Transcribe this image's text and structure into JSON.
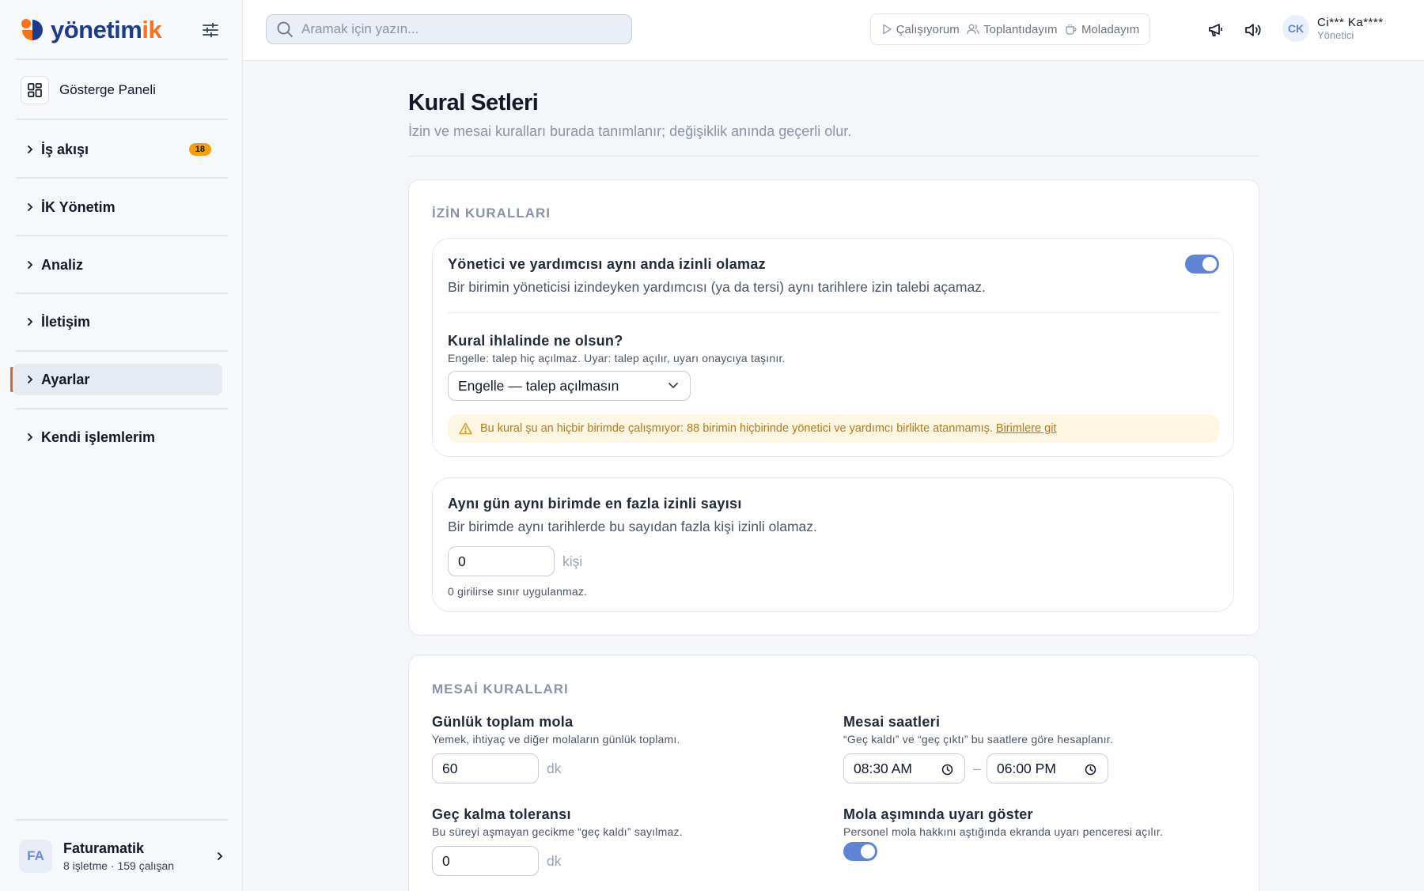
{
  "app": {
    "logo_text_main": "yönetim",
    "logo_text_accent": "ik"
  },
  "sidebar": {
    "dashboard_label": "Gösterge Paneli",
    "items": [
      {
        "label": "İş akışı",
        "badge": "18"
      },
      {
        "label": "İK Yönetim"
      },
      {
        "label": "Analiz"
      },
      {
        "label": "İletişim"
      },
      {
        "label": "Ayarlar",
        "active": true
      },
      {
        "label": "Kendi işlemlerim"
      }
    ],
    "org": {
      "initials": "FA",
      "name": "Faturamatik",
      "subtitle": "8 işletme · 159 çalışan"
    }
  },
  "topbar": {
    "search_placeholder": "Aramak için yazın...",
    "status_buttons": [
      {
        "label": "Çalışıyorum",
        "icon": "play-icon"
      },
      {
        "label": "Toplantıdayım",
        "icon": "users-icon"
      },
      {
        "label": "Moladayım",
        "icon": "coffee-icon"
      }
    ],
    "icons": [
      "megaphone-icon",
      "volume-icon"
    ],
    "user": {
      "initials": "CK",
      "name": "Ci*** Ka****",
      "role": "Yönetici"
    }
  },
  "page": {
    "title": "Kural Setleri",
    "subtitle": "İzin ve mesai kuralları burada tanımlanır; değişiklik anında geçerli olur."
  },
  "leave_rules": {
    "heading": "İZİN KURALLARI",
    "rule1": {
      "title": "Yönetici ve yardımcısı aynı anda izinli olamaz",
      "description": "Bir birimin yöneticisi izindeyken yardımcısı (ya da tersi) aynı tarihlere izin talebi açamaz.",
      "enabled": true,
      "violation_label": "Kural ihlalinde ne olsun?",
      "violation_help": "Engelle: talep hiç açılmaz. Uyar: talep açılır, uyarı onaycıya taşınır.",
      "violation_value": "Engelle — talep açılmasın",
      "warning_text": "Bu kural şu an hiçbir birimde çalışmıyor: 88 birimin hiçbirinde yönetici ve yardımcı birlikte atanmamış.",
      "warning_link": "Birimlere git"
    },
    "rule2": {
      "title": "Aynı gün aynı birimde en fazla izinli sayısı",
      "description": "Bir birimde aynı tarihlerde bu sayıdan fazla kişi izinli olamaz.",
      "value": "0",
      "unit": "kişi",
      "help": "0 girilirse sınır uygulanmaz."
    }
  },
  "work_rules": {
    "heading": "MESAİ KURALLARI",
    "daily_break": {
      "title": "Günlük toplam mola",
      "help": "Yemek, ihtiyaç ve diğer molaların günlük toplamı.",
      "value": "60",
      "unit": "dk"
    },
    "work_hours": {
      "title": "Mesai saatleri",
      "help": "“Geç kaldı” ve “geç çıktı” bu saatlere göre hesaplanır.",
      "start": "08:30 AM",
      "separator": "–",
      "end": "06:00 PM"
    },
    "late_tolerance": {
      "title": "Geç kalma toleransı",
      "help": "Bu süreyi aşmayan gecikme “geç kaldı” sayılmaz.",
      "value": "0",
      "unit": "dk"
    },
    "break_warning": {
      "title": "Mola aşımında uyarı göster",
      "help": "Personel mola hakkını aştığında ekranda uyarı penceresi açılır.",
      "enabled": true
    }
  },
  "colors": {
    "accent": "#5f84d6",
    "brand_orange": "#f97316",
    "brand_blue": "#1e3a8a",
    "warning_bg": "#fdf6e3",
    "warning_text": "#b7791f",
    "badge": "#f59e0b"
  }
}
